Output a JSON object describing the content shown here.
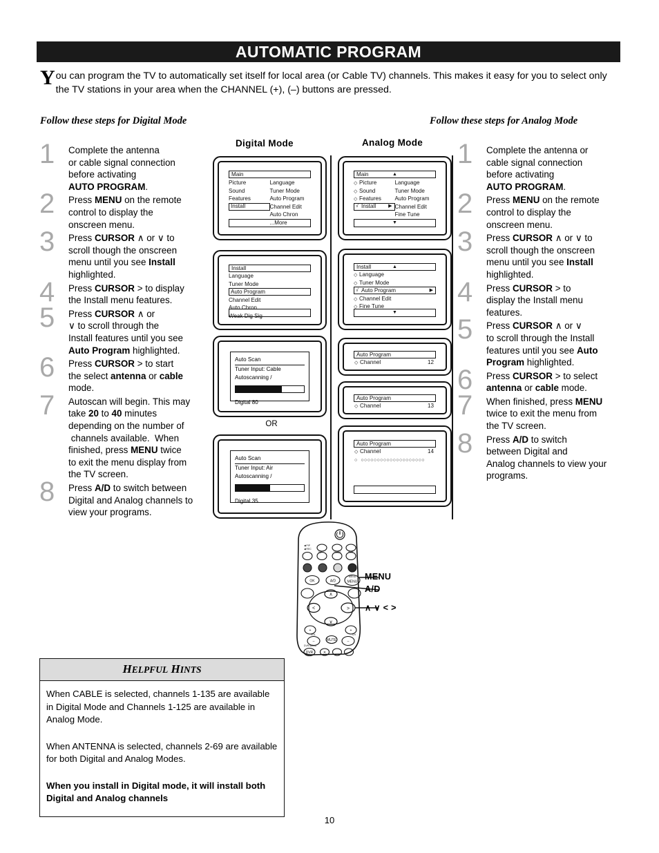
{
  "banner": {
    "title": "AUTOMATIC PROGRAM"
  },
  "intro": {
    "dropcap": "Y",
    "text": "ou can program the TV to automatically set itself for local area (or Cable TV) channels. This makes it easy for you to select only the TV stations in your area when the CHANNEL (+), (–) buttons are pressed."
  },
  "follow": {
    "digital": "Follow these steps for Digital Mode",
    "analog": "Follow these steps for Analog Mode"
  },
  "column_headings": {
    "digital": "Digital Mode",
    "analog": "Analog Mode"
  },
  "or_label": "OR",
  "digital_steps": [
    {
      "num": "1",
      "html": "Complete the antenna<br>or cable signal connection<br>before activating<br><b>AUTO PROGRAM</b>."
    },
    {
      "num": "2",
      "html": "Press <b>MENU</b> on the remote<br>control to display the<br>onscreen menu."
    },
    {
      "num": "3",
      "html": "Press <b>CURSOR</b> ∧ or ∨ to<br>scroll though the onscreen<br>menu until you see <b>Install</b><br>highlighted."
    },
    {
      "num": "4",
      "html": "Press <b>CURSOR</b> &gt; to display<br>the Install menu features."
    },
    {
      "num": "5",
      "html": "Press <b>CURSOR</b> ∧ or<br>∨ to scroll through the<br>Install features until you see<br><b>Auto Program</b> highlighted."
    },
    {
      "num": "6",
      "html": "Press <b>CURSOR</b> &gt; to start<br>the select <b>antenna</b> or <b>cable</b><br>mode."
    },
    {
      "num": "7",
      "html": "Autoscan will begin. This may<br>take <b>20</b> to <b>40</b> minutes<br>depending on the number of<br>&nbsp;channels available.&nbsp; When<br>finished, press <b>MENU</b> twice<br>to exit the menu display from<br>the TV screen."
    },
    {
      "num": "8",
      "html": "Press <b>A/D</b> to switch between<br>Digital and Analog channels to<br>view your programs."
    }
  ],
  "analog_steps": [
    {
      "num": "1",
      "html": "Complete the antenna or<br>cable signal connection<br>before activating<br><b>AUTO PROGRAM</b>."
    },
    {
      "num": "2",
      "html": "Press <b>MENU</b> on the remote<br>control to display the<br>onscreen menu."
    },
    {
      "num": "3",
      "html": "Press <b>CURSOR</b> ∧ or ∨ to<br>scroll though the onscreen<br>menu until you see <b>Install</b><br>highlighted."
    },
    {
      "num": "4",
      "html": "Press <b>CURSOR</b> &gt; to<br>display the Install menu<br>features."
    },
    {
      "num": "5",
      "html": "Press <b>CURSOR</b> ∧ or ∨<br>to scroll through the Install<br>features until you see <b>Auto<br>Program</b> highlighted."
    },
    {
      "num": "6",
      "html": "Press <b>CURSOR</b> &gt; to select<br><b>antenna</b> or <b>cable</b> mode."
    },
    {
      "num": "7",
      "html": "When finished, press <b>MENU</b><br>twice to exit the menu from<br>the TV screen."
    },
    {
      "num": "8",
      "html": "Press <b>A/D</b> to switch<br>between Digital and<br>Analog channels to view your<br>programs."
    }
  ],
  "digital_screens": {
    "main_menu": {
      "title": "Main",
      "left_items": [
        "Picture",
        "Sound",
        "Features",
        "Install"
      ],
      "selected_left": "Install",
      "right_items": [
        "Language",
        "Tuner Mode",
        "Auto Program",
        "Channel Edit",
        "Auto Chron",
        "...More"
      ]
    },
    "install_menu": {
      "title": "Install",
      "items": [
        "Language",
        "Tuner Mode",
        "Auto Program",
        "Channel Edit",
        "Auto Chron",
        "Weak Dig Sig"
      ],
      "selected": "Auto Program"
    },
    "scan_cable": {
      "title": "Auto Scan",
      "tuner_input": "Tuner Input: Cable",
      "status": "Autoscanning  /",
      "progress_percent": 68,
      "channel": "Digital 80"
    },
    "scan_air": {
      "title": "Auto Scan",
      "tuner_input": "Tuner Input: Air",
      "status": "Autoscanning  /",
      "progress_percent": 50,
      "channel": "Digital 35"
    }
  },
  "analog_screens": {
    "main_menu": {
      "title": "Main",
      "left_items": [
        "Picture",
        "Sound",
        "Features",
        "Install"
      ],
      "selected_left": "Install",
      "right_items": [
        "Language",
        "Tuner Mode",
        "Auto Program",
        "Channel Edit",
        "Fine Tune"
      ]
    },
    "install_menu": {
      "title": "Install",
      "items": [
        "Language",
        "Tuner Mode",
        "Auto Program",
        "Channel Edit",
        "Fine Tune"
      ],
      "selected": "Auto Program"
    },
    "auto_program_1": {
      "title": "Auto Program",
      "label": "Channel",
      "channel": "12"
    },
    "auto_program_2": {
      "title": "Auto Program",
      "label": "Channel",
      "channel": "13"
    },
    "auto_program_3": {
      "title": "Auto Program",
      "label": "Channel",
      "channel": "14"
    }
  },
  "remote": {
    "callouts": {
      "menu": "MENU",
      "ad": "A/D",
      "cursor": "∧  ∨  <  >"
    }
  },
  "hints": {
    "heading_big": "H",
    "heading": "HELPFUL HINTS",
    "paragraphs": [
      "When CABLE is selected, channels 1-135 are available in Digital Mode and Channels 1-125 are available in Analog Mode.",
      "When ANTENNA is selected, channels 2-69 are available for both Digital and Analog Modes.",
      "When you install in Digital mode, it will install both Digital and Analog channels"
    ]
  },
  "page_number": "10"
}
